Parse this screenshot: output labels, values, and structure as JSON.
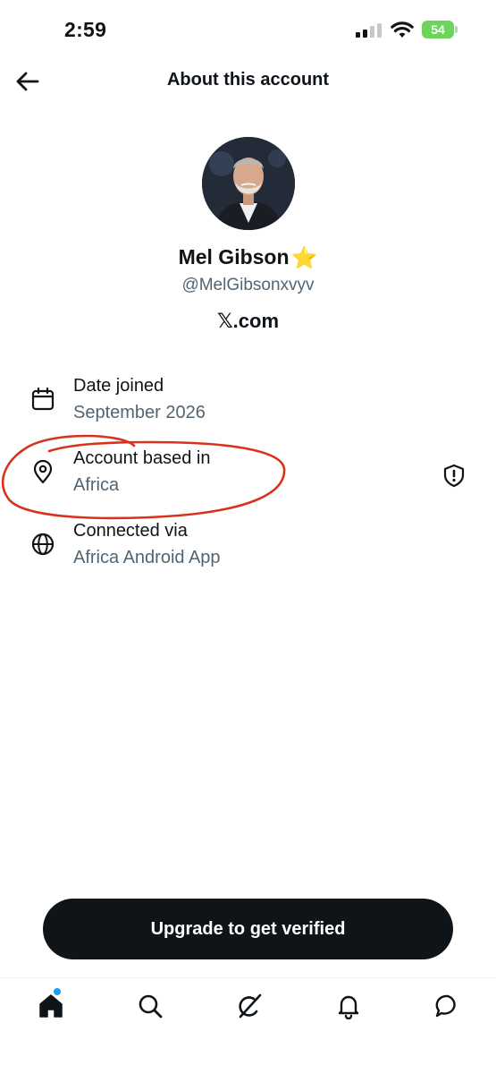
{
  "status_bar": {
    "time": "2:59",
    "battery": "54",
    "battery_color": "#6cd45a"
  },
  "header": {
    "title": "About this account",
    "back_icon": "arrow-left-icon"
  },
  "profile": {
    "name": "Mel Gibson",
    "badge_emoji": "⭐",
    "handle": "@MelGibsonxvyv",
    "site": "𝕏.com"
  },
  "details": [
    {
      "icon": "calendar-icon",
      "label": "Date joined",
      "value": "September 2026"
    },
    {
      "icon": "location-pin-icon",
      "label": "Account based in",
      "value": "Africa",
      "trailing_icon": "shield-icon"
    },
    {
      "icon": "globe-icon",
      "label": "Connected via",
      "value": "Africa Android App"
    }
  ],
  "annotation": {
    "color": "#d9321c"
  },
  "upgrade": {
    "label": "Upgrade to get verified"
  },
  "tab_bar": {
    "tabs": [
      "home-icon",
      "search-icon",
      "grok-icon",
      "bell-icon",
      "messages-icon"
    ],
    "accent": "#1d9bf0"
  }
}
